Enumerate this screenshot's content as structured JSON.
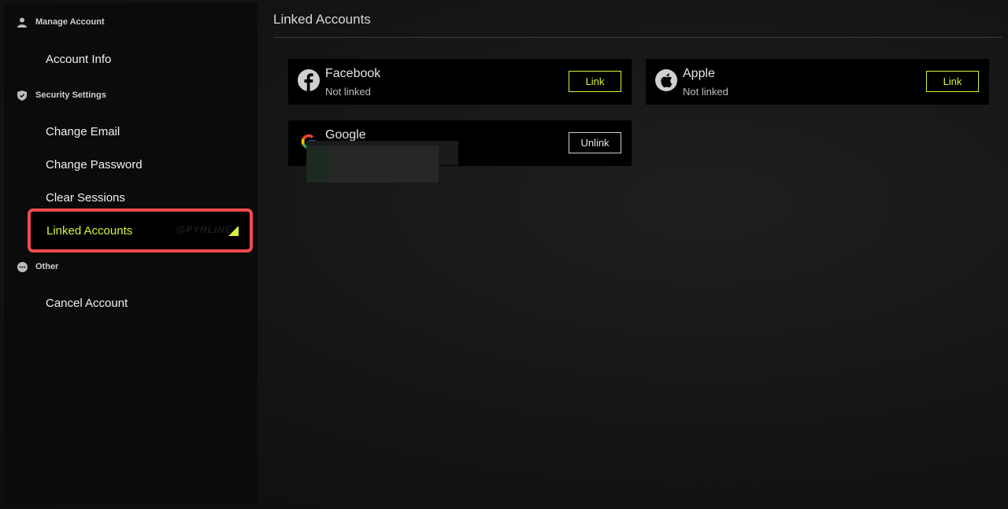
{
  "sidebar": {
    "sections": [
      {
        "title": "Manage Account",
        "icon": "user-icon"
      },
      {
        "title": "Security Settings",
        "icon": "shield-icon"
      },
      {
        "title": "Other",
        "icon": "more-icon"
      }
    ],
    "items": {
      "account_info": "Account Info",
      "change_email": "Change Email",
      "change_password": "Change Password",
      "clear_sessions": "Clear Sessions",
      "linked_accounts": "Linked Accounts",
      "cancel_account": "Cancel Account"
    },
    "active_watermark": "@PYRLINE"
  },
  "main": {
    "title": "Linked Accounts",
    "providers": [
      {
        "name": "Facebook",
        "status": "Not linked",
        "action": "Link",
        "icon": "facebook-icon"
      },
      {
        "name": "Apple",
        "status": "Not linked",
        "action": "Link",
        "icon": "apple-icon"
      },
      {
        "name": "Google",
        "status": "",
        "action": "Unlink",
        "icon": "google-icon"
      }
    ]
  },
  "colors": {
    "accent": "#dcf036",
    "highlight_border": "#f04a4f",
    "card_bg": "#000000",
    "sidebar_bg": "#0b0b0b"
  }
}
